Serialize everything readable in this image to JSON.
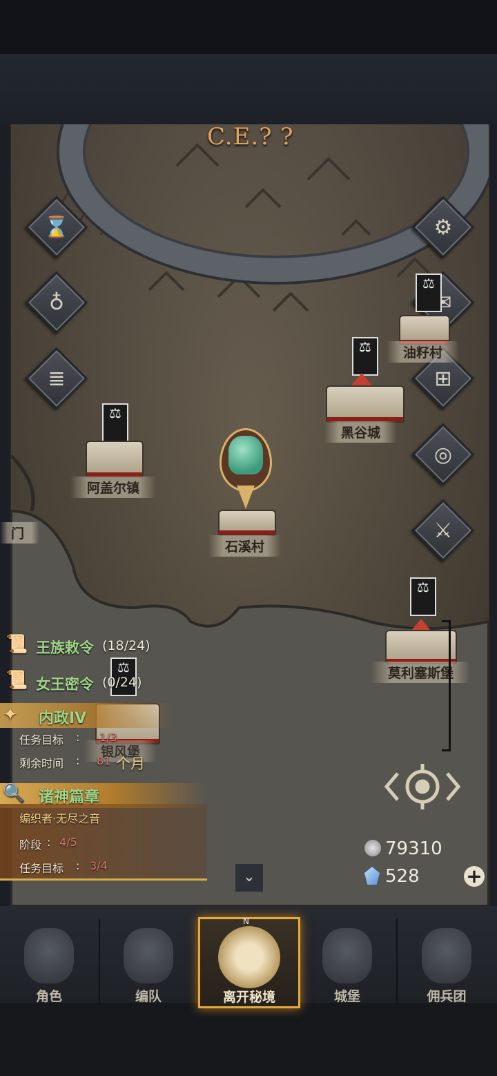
{
  "era": {
    "text": "C.E.? ?"
  },
  "side_icons": {
    "left": [
      "hourglass-icon",
      "money-bag-icon",
      "scroll-icon"
    ],
    "right": [
      "settings-icon",
      "mail-icon",
      "castle-gate-icon",
      "coin-icon",
      "helmet-sword-icon"
    ]
  },
  "towns": {
    "youzi": "油籽村",
    "heigu": "黑谷城",
    "agaer": "阿盖尔镇",
    "shixi": "石溪村",
    "moli": "莫利塞斯堡",
    "gate": "门",
    "yinfeng": "银风堡"
  },
  "quests": {
    "royal_decree": {
      "name": "王族敕令",
      "progress": "(18/24)"
    },
    "queen_secret": {
      "name": "女王密令",
      "progress": "(0/24)"
    },
    "domestic": {
      "title": "内政IV",
      "target_label": "任务目标",
      "target_value": "1/3",
      "time_label": "剩余时间",
      "time_value": "81",
      "time_unit": "个月"
    },
    "gods": {
      "title": "诸神篇章",
      "subtitle": "编织者·无尽之音",
      "stage_label": "阶段",
      "stage_value": "4/5",
      "target_label": "任务目标",
      "target_value": "3/4"
    }
  },
  "currency": {
    "silver": "79310",
    "crystal": "528"
  },
  "nav": {
    "items": [
      {
        "label": "角色",
        "icon": "knight-icon"
      },
      {
        "label": "编队",
        "icon": "formation-icon"
      },
      {
        "label": "离开秘境",
        "icon": "compass-icon",
        "active": true
      },
      {
        "label": "城堡",
        "icon": "castle-icon"
      },
      {
        "label": "佣兵团",
        "icon": "mercenary-icon"
      }
    ],
    "compass_north": "N"
  },
  "colors": {
    "accent": "#e4a93a",
    "quest_green": "#9fd58a",
    "progress_red": "#d87a70"
  }
}
